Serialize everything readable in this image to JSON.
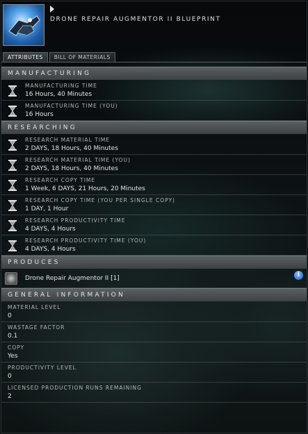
{
  "header": {
    "title": "DRONE REPAIR AUGMENTOR II BLUEPRINT",
    "icon": "blueprint-icon"
  },
  "tabs": [
    {
      "label": "ATTRIBUTES",
      "active": true
    },
    {
      "label": "BILL OF MATERIALS",
      "active": false
    }
  ],
  "manufacturing": {
    "header": "MANUFACTURING",
    "rows": [
      {
        "label": "MANUFACTURING TIME",
        "value": "16 Hours, 40 Minutes"
      },
      {
        "label": "MANUFACTURING TIME (YOU)",
        "value": "16 Hours"
      }
    ]
  },
  "researching": {
    "header": "RESEARCHING",
    "rows": [
      {
        "label": "RESEARCH MATERIAL TIME",
        "value": "2 DAYS, 18 Hours, 40 Minutes"
      },
      {
        "label": "RESEARCH MATERIAL TIME (YOU)",
        "value": "2 DAYS, 18 Hours, 40 Minutes"
      },
      {
        "label": "RESEARCH COPY TIME",
        "value": "1 Week, 6 DAYS, 21 Hours, 20 Minutes"
      },
      {
        "label": "RESEARCH COPY TIME (YOU PER SINGLE COPY)",
        "value": "1 DAY, 1 Hour"
      },
      {
        "label": "RESEARCH PRODUCTIVITY TIME",
        "value": "4 DAYS, 4 Hours"
      },
      {
        "label": "RESEARCH PRODUCTIVITY TIME (YOU)",
        "value": "4 DAYS, 4 Hours"
      }
    ]
  },
  "produces": {
    "header": "PRODUCES",
    "item": "Drone Repair Augmentor II [1]",
    "info_icon": "i"
  },
  "general": {
    "header": "GENERAL INFORMATION",
    "rows": [
      {
        "label": "MATERIAL LEVEL",
        "value": "0"
      },
      {
        "label": "WASTAGE FACTOR",
        "value": "0.1"
      },
      {
        "label": "COPY",
        "value": "Yes"
      },
      {
        "label": "PRODUCTIVITY LEVEL",
        "value": "0"
      },
      {
        "label": "LICENSED PRODUCTION RUNS REMAINING",
        "value": "2"
      }
    ]
  },
  "colors": {
    "section_header": "#4a4f52",
    "info_icon": "#1e63c9",
    "icon_bg": "#3a86d8"
  }
}
